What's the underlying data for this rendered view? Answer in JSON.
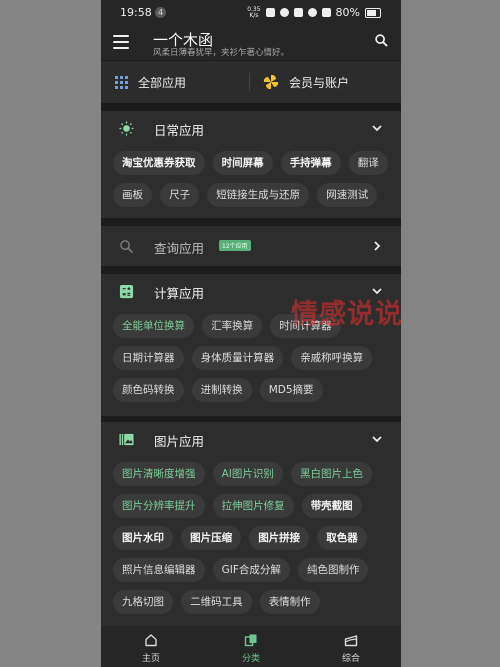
{
  "status_bar": {
    "time": "19:58",
    "badge": "4",
    "speed_top": "0.35",
    "speed_bottom": "K/s",
    "battery": "80%"
  },
  "app_bar": {
    "title": "一个木函",
    "subtitle": "风柔日薄春犹早，夹衫乍著心情好。"
  },
  "quick": {
    "all_apps": "全部应用",
    "membership": "会员与账户"
  },
  "sections": {
    "daily": {
      "title": "日常应用",
      "chips": [
        "淘宝优惠券获取",
        "时间屏幕",
        "手持弹幕",
        "翻译",
        "画板",
        "尺子",
        "短链接生成与还原",
        "网速测试"
      ]
    },
    "query": {
      "title": "查询应用",
      "tag": "12个应用"
    },
    "calc": {
      "title": "计算应用",
      "chips": [
        "全能单位换算",
        "汇率换算",
        "时间计算器",
        "日期计算器",
        "身体质量计算器",
        "亲戚称呼换算",
        "颜色码转换",
        "进制转换",
        "MD5摘要"
      ]
    },
    "image": {
      "title": "图片应用",
      "chips": [
        "图片清晰度增强",
        "AI图片识别",
        "黑白图片上色",
        "图片分辨率提升",
        "拉伸图片修复",
        "带壳截图",
        "图片水印",
        "图片压缩",
        "图片拼接",
        "取色器",
        "照片信息编辑器",
        "GIF合成分解",
        "纯色图制作",
        "九格切图",
        "二维码工具",
        "表情制作"
      ]
    }
  },
  "watermark": "情感说说",
  "bottom_nav": {
    "home": "主页",
    "category": "分类",
    "overview": "综合"
  },
  "colors": {
    "accent_green": "#6fc58f",
    "chip_bg": "#3a3a3a",
    "section_bg": "#2d2d2d",
    "page_bg": "#1b1b1b"
  }
}
